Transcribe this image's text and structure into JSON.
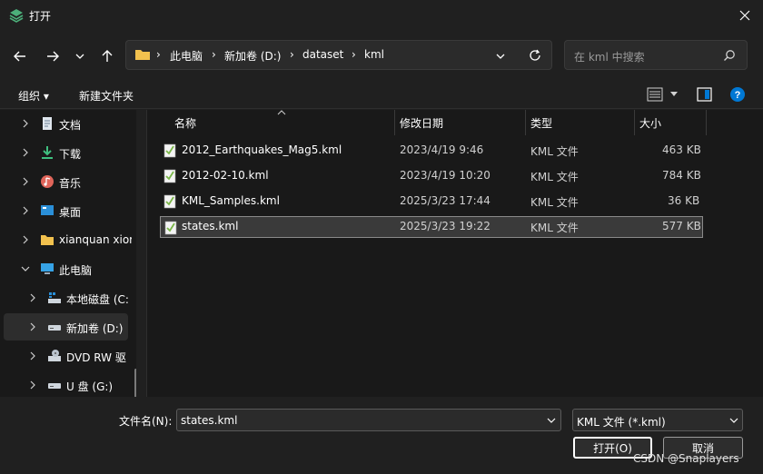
{
  "window": {
    "title": "打开",
    "close_icon": "close-icon"
  },
  "nav": {
    "breadcrumbs": [
      "此电脑",
      "新加卷 (D:)",
      "dataset",
      "kml"
    ],
    "search_placeholder": "在 kml 中搜索"
  },
  "toolbar": {
    "organize": "组织 ▾",
    "new_folder": "新建文件夹"
  },
  "sidebar": {
    "items": [
      {
        "label": "文档",
        "icon": "document-icon"
      },
      {
        "label": "下载",
        "icon": "download-icon"
      },
      {
        "label": "音乐",
        "icon": "music-icon"
      },
      {
        "label": "桌面",
        "icon": "desktop-icon"
      },
      {
        "label": "xianquan xior",
        "icon": "folder-icon"
      },
      {
        "label": "此电脑",
        "icon": "computer-icon",
        "expanded": true
      },
      {
        "label": "本地磁盘 (C:)",
        "icon": "drive-c-icon"
      },
      {
        "label": "新加卷 (D:)",
        "icon": "drive-icon",
        "selected": true
      },
      {
        "label": "DVD RW 驱",
        "icon": "dvd-icon"
      },
      {
        "label": "U 盘 (G:)",
        "icon": "usb-drive-icon"
      }
    ]
  },
  "files": {
    "columns": {
      "name": "名称",
      "modified": "修改日期",
      "type": "类型",
      "size": "大小"
    },
    "rows": [
      {
        "name": "2012_Earthquakes_Mag5.kml",
        "modified": "2023/4/19 9:46",
        "type": "KML 文件",
        "size": "463 KB"
      },
      {
        "name": "2012-02-10.kml",
        "modified": "2023/4/19 10:20",
        "type": "KML 文件",
        "size": "784 KB"
      },
      {
        "name": "KML_Samples.kml",
        "modified": "2025/3/23 17:44",
        "type": "KML 文件",
        "size": "36 KB"
      },
      {
        "name": "states.kml",
        "modified": "2025/3/23 19:22",
        "type": "KML 文件",
        "size": "577 KB",
        "selected": true
      }
    ]
  },
  "footer": {
    "filename_label": "文件名(N):",
    "filename_value": "states.kml",
    "filetype_value": "KML 文件 (*.kml)",
    "open_button": "打开(O)",
    "cancel_button": "取消",
    "watermark": "CSDN @Snaplayers"
  },
  "colors": {
    "accent_help": "#0078d4",
    "folder": "#f2c14e",
    "selected_border": "#8a8a8a"
  }
}
